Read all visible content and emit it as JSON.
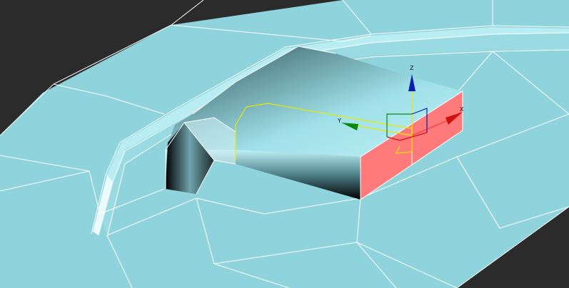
{
  "viewport": {
    "colors": {
      "background": "#2b2b2b",
      "surface": "#8fd3dc",
      "surface_shade": "#7fc6d0",
      "wire": "#ffffff",
      "selected_face": "#ff7a7a",
      "spline": "#e8e800",
      "gizmo_x": "#cc1111",
      "gizmo_y": "#0a8a0a",
      "gizmo_z": "#0a1fb0"
    },
    "gizmo": {
      "x_label": "X",
      "y_label": "Y",
      "z_label": "Z"
    }
  }
}
